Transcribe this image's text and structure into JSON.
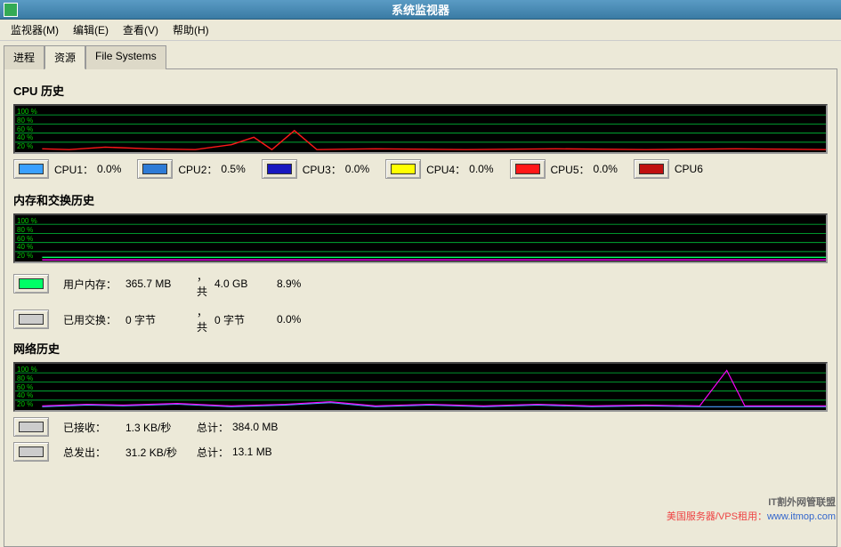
{
  "window": {
    "title": "系统监视器"
  },
  "menu": {
    "monitor": "监视器(M)",
    "edit": "编辑(E)",
    "view": "查看(V)",
    "help": "帮助(H)"
  },
  "tabs": {
    "processes": "进程",
    "resources": "资源",
    "filesystems": "File Systems"
  },
  "cpu": {
    "title": "CPU 历史",
    "items": [
      {
        "label": "CPU1：",
        "val": "0.0%",
        "color": "#3aa0ff"
      },
      {
        "label": "CPU2：",
        "val": "0.5%",
        "color": "#2e7bd6"
      },
      {
        "label": "CPU3：",
        "val": "0.0%",
        "color": "#1818c0"
      },
      {
        "label": "CPU4：",
        "val": "0.0%",
        "color": "#ffff00"
      },
      {
        "label": "CPU5：",
        "val": "0.0%",
        "color": "#ff1818"
      },
      {
        "label": "CPU6",
        "val": "",
        "color": "#c01010"
      }
    ]
  },
  "mem": {
    "title": "内存和交换历史",
    "user_mem": {
      "label": "用户内存：",
      "val": "365.7 MB",
      "total_label": "，共",
      "total": "4.0 GB",
      "pct": "8.9%",
      "color": "#00ff66"
    },
    "swap": {
      "label": "已用交换：",
      "val": "0 字节",
      "total_label": "，共",
      "total": "0 字节",
      "pct": "0.0%",
      "color": "#cccccc"
    }
  },
  "net": {
    "title": "网络历史",
    "recv": {
      "label": "已接收：",
      "val": "1.3 KB/秒",
      "total_label": "总计：",
      "total": "384.0 MB",
      "color": "#cccccc"
    },
    "sent": {
      "label": "总发出：",
      "val": "31.2 KB/秒",
      "total_label": "总计：",
      "total": "13.1 MB",
      "color": "#cccccc"
    }
  },
  "ylabels": [
    "100 %",
    "80 %",
    "60 %",
    "40 %",
    "20 %"
  ],
  "watermark1": "IT割外网管联盟",
  "watermark2_a": "美国服务器/VPS租用：",
  "watermark2_b": "www.itmop.com",
  "chart_data": [
    {
      "type": "line",
      "title": "CPU 历史",
      "ylabel": "%",
      "ylim": [
        0,
        100
      ],
      "series": [
        {
          "name": "CPU1",
          "color": "#3aa0ff",
          "values_hint": "flat near 0"
        },
        {
          "name": "CPU2",
          "color": "#2e7bd6",
          "values_hint": "flat near 0"
        },
        {
          "name": "CPU3",
          "color": "#1818c0",
          "values_hint": "flat near 0"
        },
        {
          "name": "CPU4",
          "color": "#ffff00",
          "values_hint": "flat near 0"
        },
        {
          "name": "CPU5",
          "color": "#ff1818",
          "values_hint": "mostly ~5%, two spikes to ~25-30% near middle"
        },
        {
          "name": "CPU6",
          "color": "#c01010",
          "values_hint": "flat near 0"
        }
      ]
    },
    {
      "type": "line",
      "title": "内存和交换历史",
      "ylabel": "%",
      "ylim": [
        0,
        100
      ],
      "series": [
        {
          "name": "用户内存",
          "color": "#00ff66",
          "values_hint": "flat ~9%"
        },
        {
          "name": "交换",
          "color": "#ff00ff",
          "values_hint": "flat 0% (shown as thin magenta line at bottom)"
        }
      ]
    },
    {
      "type": "line",
      "title": "网络历史",
      "ylabel": "%",
      "ylim": [
        0,
        100
      ],
      "series": [
        {
          "name": "已接收",
          "color": "#4aa0ff",
          "values_hint": "low wavy near 5-10%"
        },
        {
          "name": "总发出",
          "color": "#ff00ff",
          "values_hint": "low wavy, single spike to ~90% near right"
        }
      ]
    }
  ]
}
